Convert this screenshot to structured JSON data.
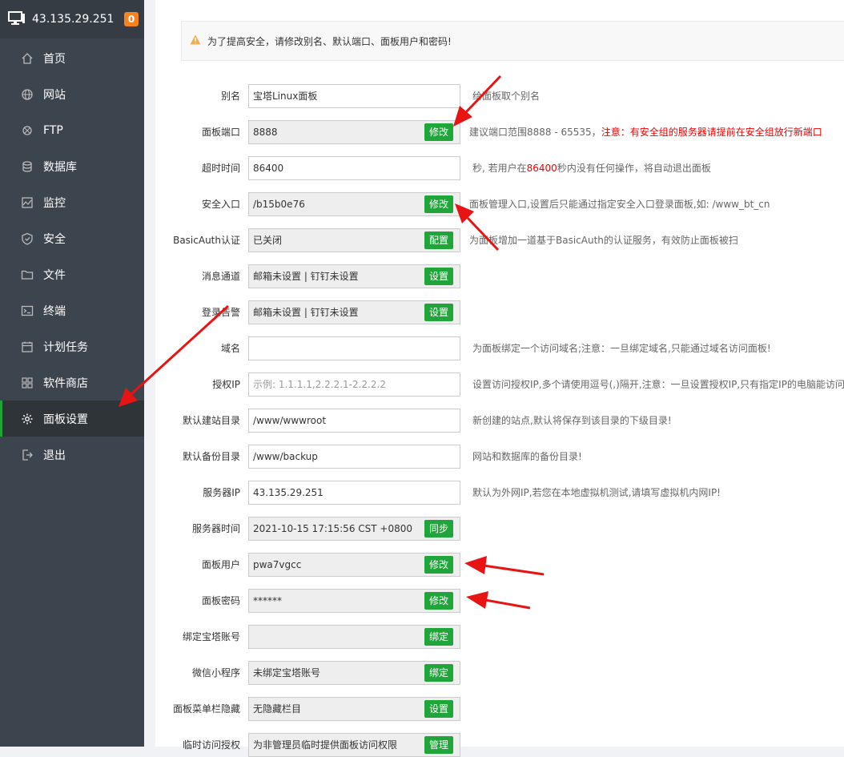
{
  "header": {
    "ip": "43.135.29.251",
    "badge": "0"
  },
  "nav": [
    {
      "label": "首页",
      "icon": "home-icon"
    },
    {
      "label": "网站",
      "icon": "globe-icon"
    },
    {
      "label": "FTP",
      "icon": "ftp-icon"
    },
    {
      "label": "数据库",
      "icon": "database-icon"
    },
    {
      "label": "监控",
      "icon": "monitor-icon"
    },
    {
      "label": "安全",
      "icon": "shield-icon"
    },
    {
      "label": "文件",
      "icon": "folder-icon"
    },
    {
      "label": "终端",
      "icon": "terminal-icon"
    },
    {
      "label": "计划任务",
      "icon": "calendar-icon"
    },
    {
      "label": "软件商店",
      "icon": "apps-icon"
    },
    {
      "label": "面板设置",
      "icon": "gear-icon"
    },
    {
      "label": "退出",
      "icon": "logout-icon"
    }
  ],
  "alert": "为了提高安全，请修改别名、默认端口、面板用户和密码!",
  "settings": {
    "alias": {
      "label": "别名",
      "value": "宝塔Linux面板",
      "hint": "给面板取个别名"
    },
    "port": {
      "label": "面板端口",
      "value": "8888",
      "button": "修改",
      "hint": "建议端口范围8888 - 65535，",
      "hint_warn": "注意：有安全组的服务器请提前在安全组放行新端口"
    },
    "timeout": {
      "label": "超时时间",
      "value": "86400",
      "hint_a": "秒, 若用户在",
      "hint_num": "86400",
      "hint_b": "秒内没有任何操作，将自动退出面板"
    },
    "entry": {
      "label": "安全入口",
      "value": "/b15b0e76",
      "button": "修改",
      "hint": "面板管理入口,设置后只能通过指定安全入口登录面板,如: /www_bt_cn"
    },
    "basicauth": {
      "label": "BasicAuth认证",
      "value": "已关闭",
      "button": "配置",
      "hint": "为面板增加一道基于BasicAuth的认证服务，有效防止面板被扫"
    },
    "message": {
      "label": "消息通道",
      "value": "邮箱未设置 | 钉钉未设置",
      "button": "设置"
    },
    "login_alert": {
      "label": "登录告警",
      "value": "邮箱未设置 | 钉钉未设置",
      "button": "设置"
    },
    "domain": {
      "label": "域名",
      "value": "",
      "hint": "为面板绑定一个访问域名;注意：一旦绑定域名,只能通过域名访问面板!"
    },
    "auth_ip": {
      "label": "授权IP",
      "placeholder": "示例: 1.1.1.1,2.2.2.1-2.2.2.2",
      "hint": "设置访问授权IP,多个请使用逗号(,)隔开,注意：一旦设置授权IP,只有指定IP的电脑能访问面板!"
    },
    "site_dir": {
      "label": "默认建站目录",
      "value": "/www/wwwroot",
      "hint": "新创建的站点,默认将保存到该目录的下级目录!"
    },
    "backup_dir": {
      "label": "默认备份目录",
      "value": "/www/backup",
      "hint": "网站和数据库的备份目录!"
    },
    "server_ip": {
      "label": "服务器IP",
      "value": "43.135.29.251",
      "hint": "默认为外网IP,若您在本地虚拟机测试,请填写虚拟机内网IP!"
    },
    "server_time": {
      "label": "服务器时间",
      "value": "2021-10-15 17:15:56 CST +0800",
      "button": "同步"
    },
    "user": {
      "label": "面板用户",
      "value": "pwa7vgcc",
      "button": "修改"
    },
    "password": {
      "label": "面板密码",
      "value": "******",
      "button": "修改"
    },
    "bt_account": {
      "label": "绑定宝塔账号",
      "value": "",
      "button": "绑定"
    },
    "wechat": {
      "label": "微信小程序",
      "value": "未绑定宝塔账号",
      "button": "绑定"
    },
    "menu_hide": {
      "label": "面板菜单栏隐藏",
      "value": "无隐藏栏目",
      "button": "设置"
    },
    "temp_access": {
      "label": "临时访问授权",
      "value": "为非管理员临时提供面板访问权限",
      "button": "管理"
    }
  },
  "colors": {
    "sidebar": "#3c444d",
    "accent": "#20a53a",
    "badge": "#f5811f",
    "arrow": "#e81414"
  }
}
